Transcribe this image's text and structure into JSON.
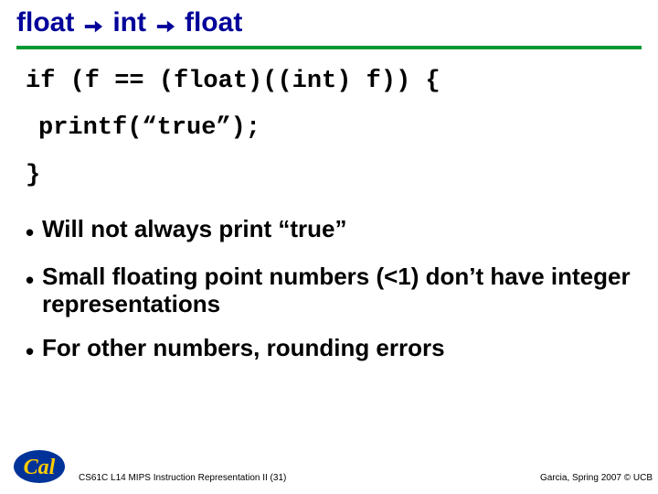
{
  "title": {
    "part1": "float",
    "part2": "int",
    "part3": "float"
  },
  "code": {
    "line1": "if (f == (float)((int) f)) {",
    "line2": "printf(“true”);",
    "line3": "}"
  },
  "bullets": [
    "Will not always print “true”",
    "Small floating point numbers (<1) don’t have integer representations",
    "For other numbers, rounding errors"
  ],
  "footer": {
    "left": "CS61C L14 MIPS Instruction Representation II (31)",
    "right": "Garcia, Spring 2007 © UCB",
    "logo_text": "Cal"
  },
  "colors": {
    "title": "#000099",
    "underline": "#009933",
    "logo_bg": "#003399",
    "logo_script": "#ffcc00"
  }
}
